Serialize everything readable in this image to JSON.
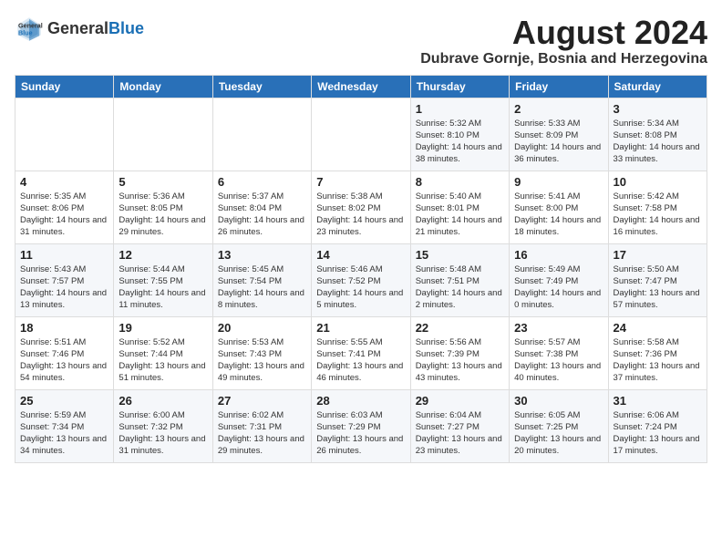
{
  "logo": {
    "general": "General",
    "blue": "Blue"
  },
  "header": {
    "month_year": "August 2024",
    "location": "Dubrave Gornje, Bosnia and Herzegovina"
  },
  "days_of_week": [
    "Sunday",
    "Monday",
    "Tuesday",
    "Wednesday",
    "Thursday",
    "Friday",
    "Saturday"
  ],
  "weeks": [
    [
      {
        "day": "",
        "info": ""
      },
      {
        "day": "",
        "info": ""
      },
      {
        "day": "",
        "info": ""
      },
      {
        "day": "",
        "info": ""
      },
      {
        "day": "1",
        "info": "Sunrise: 5:32 AM\nSunset: 8:10 PM\nDaylight: 14 hours\nand 38 minutes."
      },
      {
        "day": "2",
        "info": "Sunrise: 5:33 AM\nSunset: 8:09 PM\nDaylight: 14 hours\nand 36 minutes."
      },
      {
        "day": "3",
        "info": "Sunrise: 5:34 AM\nSunset: 8:08 PM\nDaylight: 14 hours\nand 33 minutes."
      }
    ],
    [
      {
        "day": "4",
        "info": "Sunrise: 5:35 AM\nSunset: 8:06 PM\nDaylight: 14 hours\nand 31 minutes."
      },
      {
        "day": "5",
        "info": "Sunrise: 5:36 AM\nSunset: 8:05 PM\nDaylight: 14 hours\nand 29 minutes."
      },
      {
        "day": "6",
        "info": "Sunrise: 5:37 AM\nSunset: 8:04 PM\nDaylight: 14 hours\nand 26 minutes."
      },
      {
        "day": "7",
        "info": "Sunrise: 5:38 AM\nSunset: 8:02 PM\nDaylight: 14 hours\nand 23 minutes."
      },
      {
        "day": "8",
        "info": "Sunrise: 5:40 AM\nSunset: 8:01 PM\nDaylight: 14 hours\nand 21 minutes."
      },
      {
        "day": "9",
        "info": "Sunrise: 5:41 AM\nSunset: 8:00 PM\nDaylight: 14 hours\nand 18 minutes."
      },
      {
        "day": "10",
        "info": "Sunrise: 5:42 AM\nSunset: 7:58 PM\nDaylight: 14 hours\nand 16 minutes."
      }
    ],
    [
      {
        "day": "11",
        "info": "Sunrise: 5:43 AM\nSunset: 7:57 PM\nDaylight: 14 hours\nand 13 minutes."
      },
      {
        "day": "12",
        "info": "Sunrise: 5:44 AM\nSunset: 7:55 PM\nDaylight: 14 hours\nand 11 minutes."
      },
      {
        "day": "13",
        "info": "Sunrise: 5:45 AM\nSunset: 7:54 PM\nDaylight: 14 hours\nand 8 minutes."
      },
      {
        "day": "14",
        "info": "Sunrise: 5:46 AM\nSunset: 7:52 PM\nDaylight: 14 hours\nand 5 minutes."
      },
      {
        "day": "15",
        "info": "Sunrise: 5:48 AM\nSunset: 7:51 PM\nDaylight: 14 hours\nand 2 minutes."
      },
      {
        "day": "16",
        "info": "Sunrise: 5:49 AM\nSunset: 7:49 PM\nDaylight: 14 hours\nand 0 minutes."
      },
      {
        "day": "17",
        "info": "Sunrise: 5:50 AM\nSunset: 7:47 PM\nDaylight: 13 hours\nand 57 minutes."
      }
    ],
    [
      {
        "day": "18",
        "info": "Sunrise: 5:51 AM\nSunset: 7:46 PM\nDaylight: 13 hours\nand 54 minutes."
      },
      {
        "day": "19",
        "info": "Sunrise: 5:52 AM\nSunset: 7:44 PM\nDaylight: 13 hours\nand 51 minutes."
      },
      {
        "day": "20",
        "info": "Sunrise: 5:53 AM\nSunset: 7:43 PM\nDaylight: 13 hours\nand 49 minutes."
      },
      {
        "day": "21",
        "info": "Sunrise: 5:55 AM\nSunset: 7:41 PM\nDaylight: 13 hours\nand 46 minutes."
      },
      {
        "day": "22",
        "info": "Sunrise: 5:56 AM\nSunset: 7:39 PM\nDaylight: 13 hours\nand 43 minutes."
      },
      {
        "day": "23",
        "info": "Sunrise: 5:57 AM\nSunset: 7:38 PM\nDaylight: 13 hours\nand 40 minutes."
      },
      {
        "day": "24",
        "info": "Sunrise: 5:58 AM\nSunset: 7:36 PM\nDaylight: 13 hours\nand 37 minutes."
      }
    ],
    [
      {
        "day": "25",
        "info": "Sunrise: 5:59 AM\nSunset: 7:34 PM\nDaylight: 13 hours\nand 34 minutes."
      },
      {
        "day": "26",
        "info": "Sunrise: 6:00 AM\nSunset: 7:32 PM\nDaylight: 13 hours\nand 31 minutes."
      },
      {
        "day": "27",
        "info": "Sunrise: 6:02 AM\nSunset: 7:31 PM\nDaylight: 13 hours\nand 29 minutes."
      },
      {
        "day": "28",
        "info": "Sunrise: 6:03 AM\nSunset: 7:29 PM\nDaylight: 13 hours\nand 26 minutes."
      },
      {
        "day": "29",
        "info": "Sunrise: 6:04 AM\nSunset: 7:27 PM\nDaylight: 13 hours\nand 23 minutes."
      },
      {
        "day": "30",
        "info": "Sunrise: 6:05 AM\nSunset: 7:25 PM\nDaylight: 13 hours\nand 20 minutes."
      },
      {
        "day": "31",
        "info": "Sunrise: 6:06 AM\nSunset: 7:24 PM\nDaylight: 13 hours\nand 17 minutes."
      }
    ]
  ]
}
